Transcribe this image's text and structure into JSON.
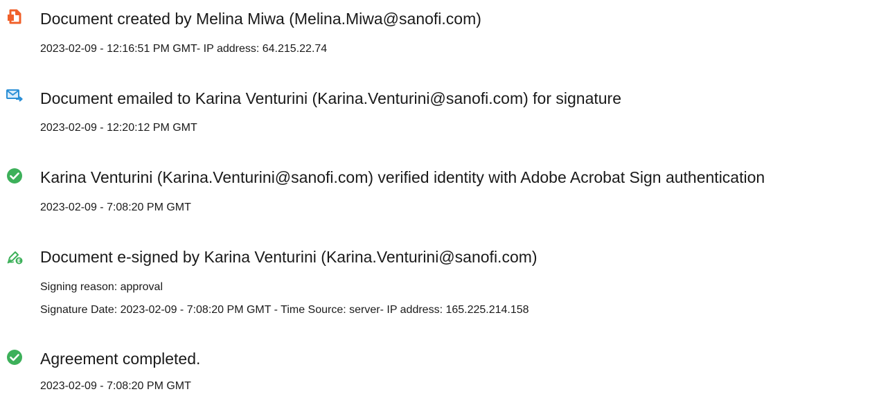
{
  "events": [
    {
      "icon": "document-created-icon",
      "icon_color": "#f0602a",
      "title": "Document created by Melina Miwa (Melina.Miwa@sanofi.com)",
      "details": [
        "2023-02-09 - 12:16:51 PM GMT- IP address: 64.215.22.74"
      ]
    },
    {
      "icon": "email-sent-icon",
      "icon_color": "#2a8fd6",
      "title": "Document emailed to Karina Venturini (Karina.Venturini@sanofi.com) for signature",
      "details": [
        "2023-02-09 - 12:20:12 PM GMT"
      ]
    },
    {
      "icon": "verified-check-icon",
      "icon_color": "#3db05a",
      "title": "Karina Venturini (Karina.Venturini@sanofi.com) verified identity with Adobe Acrobat Sign authentication",
      "details": [
        "2023-02-09 - 7:08:20 PM GMT"
      ]
    },
    {
      "icon": "e-sign-pen-icon",
      "icon_color": "#3db05a",
      "title": "Document e-signed by Karina Venturini (Karina.Venturini@sanofi.com)",
      "details": [
        "Signing reason: approval",
        "Signature Date: 2023-02-09 - 7:08:20 PM GMT - Time Source: server- IP address: 165.225.214.158"
      ]
    },
    {
      "icon": "completed-check-icon",
      "icon_color": "#3db05a",
      "title": "Agreement completed.",
      "details": [
        "2023-02-09 - 7:08:20 PM GMT"
      ]
    }
  ]
}
